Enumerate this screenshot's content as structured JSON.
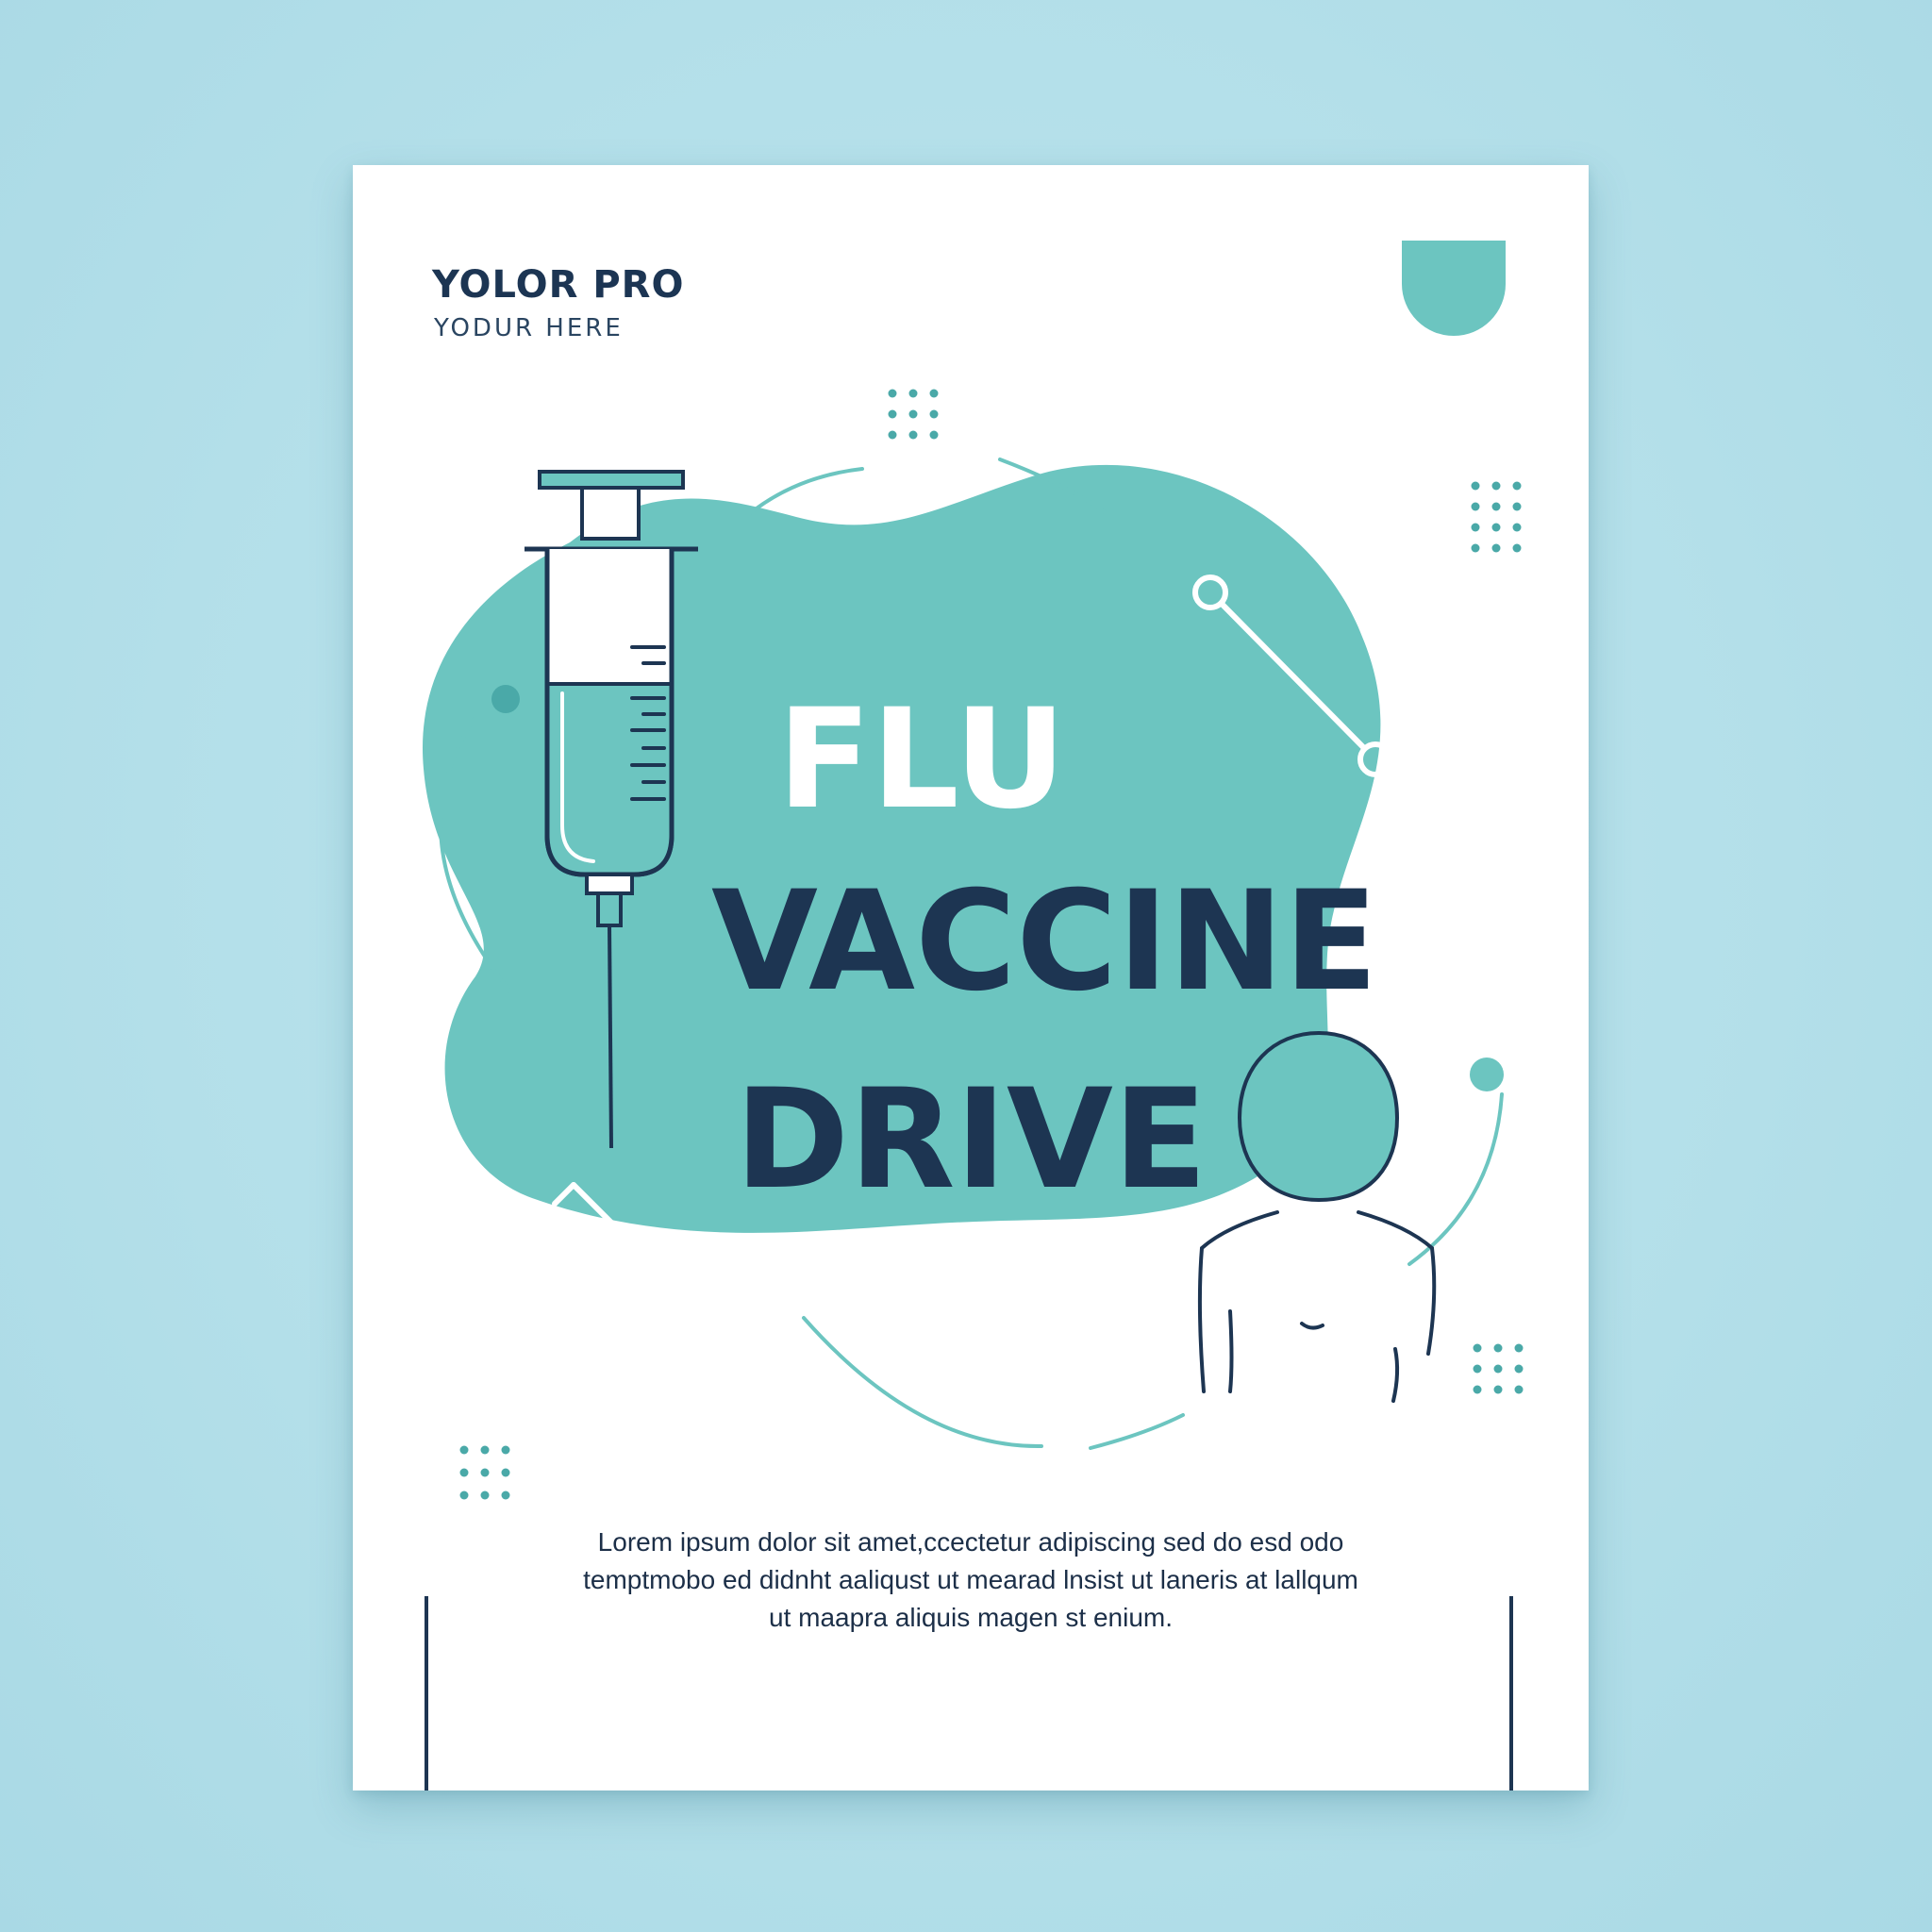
{
  "brand": {
    "title": "YOLOR PRO",
    "subtitle": "YODUR HERE"
  },
  "headline": {
    "line1": "FLU",
    "line2": "VACCINE",
    "line3": "DRIVE"
  },
  "body": {
    "text": "Lorem ipsum dolor sit amet,ccectetur adipiscing sed do esd odo temptmobo ed didnht aaliqust ut mearad lnsist ut laneris at lallqum ut maapra aliquis magen st enium."
  },
  "icons": [
    "syringe-icon",
    "person-icon",
    "pin-icon",
    "dot-grid-icon"
  ],
  "colors": {
    "background": "#b5e1eb",
    "teal": "#6cc5c0",
    "navy": "#1d3552",
    "white": "#ffffff"
  }
}
